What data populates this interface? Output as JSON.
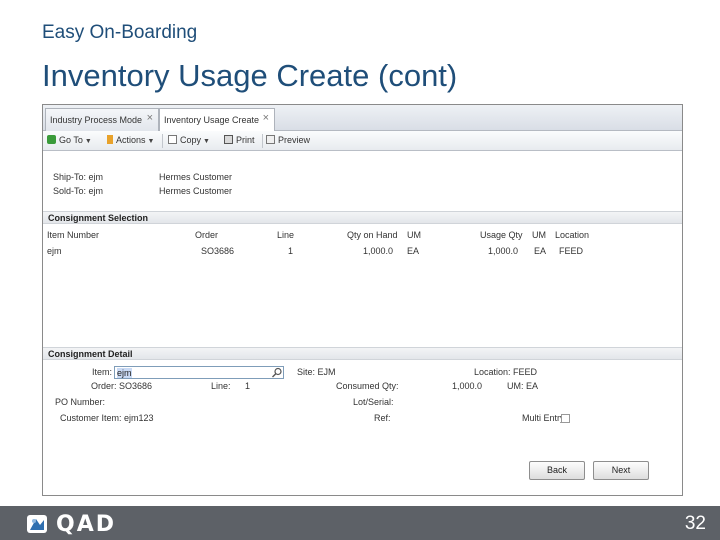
{
  "slide": {
    "kicker": "Easy On-Boarding",
    "title": "Inventory Usage Create (cont)",
    "page_number": "32",
    "logo_text": "QAD"
  },
  "tabs": [
    {
      "label": "Industry Process Mode",
      "active": false,
      "closable": true
    },
    {
      "label": "Inventory Usage Create",
      "active": true,
      "closable": true
    }
  ],
  "toolbar": {
    "goto": "Go To",
    "actions": "Actions",
    "copy": "Copy",
    "print": "Print",
    "preview": "Preview"
  },
  "header_fields": {
    "ship_to_label": "Ship-To: ejm",
    "ship_to_value": "Hermes Customer",
    "sold_to_label": "Sold-To: ejm",
    "sold_to_value": "Hermes Customer"
  },
  "consignment_selection": {
    "title": "Consignment Selection",
    "columns": [
      "Item Number",
      "Order",
      "Line",
      "Qty on Hand",
      "UM",
      "Usage Qty",
      "UM",
      "Location"
    ],
    "rows": [
      [
        "ejm",
        "SO3686",
        "1",
        "1,000.0",
        "EA",
        "1,000.0",
        "EA",
        "FEED"
      ]
    ]
  },
  "consignment_detail": {
    "title": "Consignment Detail",
    "item_label": "Item:",
    "item_value": "ejm",
    "site_label": "Site: EJM",
    "location_label": "Location: FEED",
    "order_label": "Order: SO3686",
    "line_label": "Line:",
    "line_value": "1",
    "consumed_qty_label": "Consumed Qty:",
    "consumed_qty_value": "1,000.0",
    "um_label": "UM: EA",
    "po_number_label": "PO Number:",
    "lot_serial_label": "Lot/Serial:",
    "customer_item_label": "Customer Item: ejm123",
    "ref_label": "Ref:",
    "multi_entry_label": "Multi Entry:"
  },
  "buttons": {
    "back": "Back",
    "next": "Next"
  },
  "colors": {
    "title": "#1f4e79",
    "footer": "#5d6167"
  }
}
